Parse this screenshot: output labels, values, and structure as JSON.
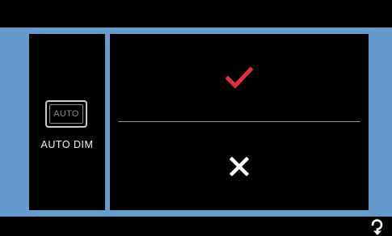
{
  "setting": {
    "icon_text": "AUTO",
    "label": "AUTO DIM"
  },
  "options": {
    "confirm_icon": "checkmark-icon",
    "cancel_icon": "x-icon"
  },
  "nav": {
    "back_icon": "back-arrow-icon"
  },
  "colors": {
    "frame": "#6699cc",
    "confirm": "#e0323c",
    "cancel": "#ffffff",
    "background": "#000000"
  }
}
